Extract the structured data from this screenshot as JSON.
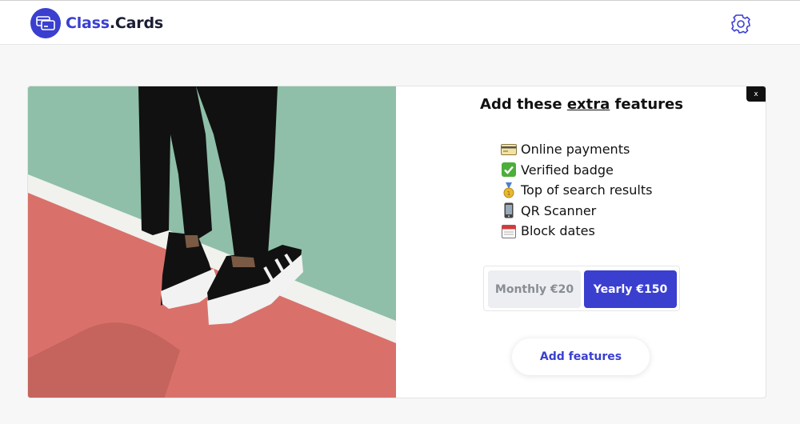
{
  "header": {
    "brand_part1": "Class",
    "brand_part2": ".Cards",
    "accent_color": "#3a3fcf",
    "logo_icon": "card-icon",
    "settings_icon": "gear-icon"
  },
  "modal": {
    "close_label": "x",
    "image_icon": "sneakers-photo",
    "title_before": "Add these ",
    "title_emphasis": "extra",
    "title_after": " features",
    "features": [
      {
        "icon": "credit-card-icon",
        "label": "Online payments"
      },
      {
        "icon": "check-mark-icon",
        "label": "Verified badge"
      },
      {
        "icon": "medal-icon",
        "label": "Top of search results"
      },
      {
        "icon": "phone-icon",
        "label": "QR Scanner"
      },
      {
        "icon": "calendar-icon",
        "label": "Block dates"
      }
    ],
    "plans": {
      "monthly": "Monthly €20",
      "yearly": "Yearly €150",
      "selected": "yearly"
    },
    "cta": "Add features"
  }
}
